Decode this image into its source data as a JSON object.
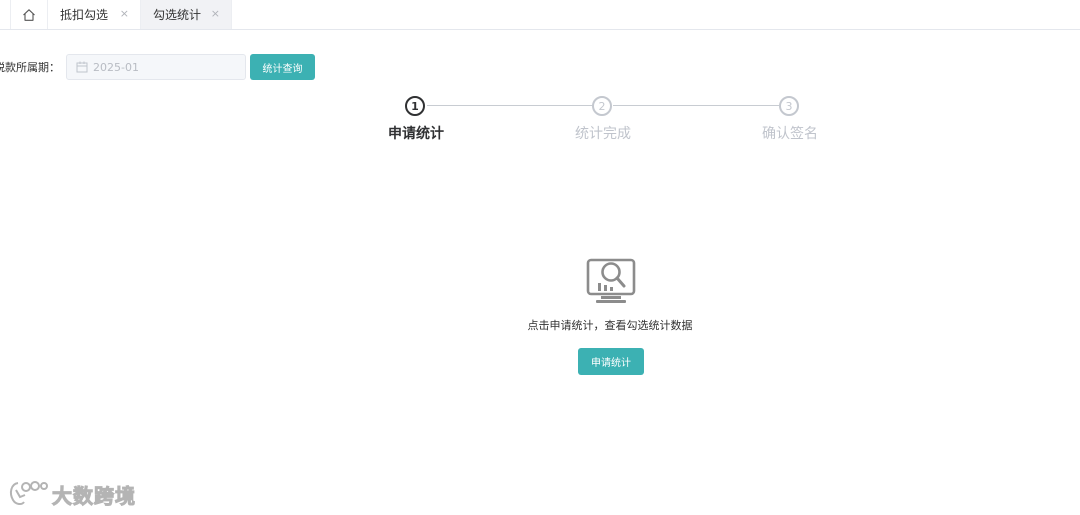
{
  "tabs": {
    "home_icon": "home-icon",
    "items": [
      {
        "label": "抵扣勾选",
        "close": "×",
        "active": false
      },
      {
        "label": "勾选统计",
        "close": "×",
        "active": true
      }
    ]
  },
  "filter": {
    "period_label": "税款所属期：",
    "period_value": "2025-01",
    "query_button": "统计查询"
  },
  "steps": [
    {
      "number": "1",
      "title": "申请统计",
      "state": "active"
    },
    {
      "number": "2",
      "title": "统计完成",
      "state": "pending"
    },
    {
      "number": "3",
      "title": "确认签名",
      "state": "pending"
    }
  ],
  "empty_state": {
    "icon": "monitor-search-icon",
    "hint": "点击申请统计，查看勾选统计数据",
    "apply_button": "申请统计"
  },
  "watermark": {
    "text": "大数跨境"
  },
  "colors": {
    "accent": "#3cb1b3",
    "active_step": "#303133",
    "inactive_step": "#c0c4cc",
    "tab_active_bg": "#f1f2f5"
  }
}
